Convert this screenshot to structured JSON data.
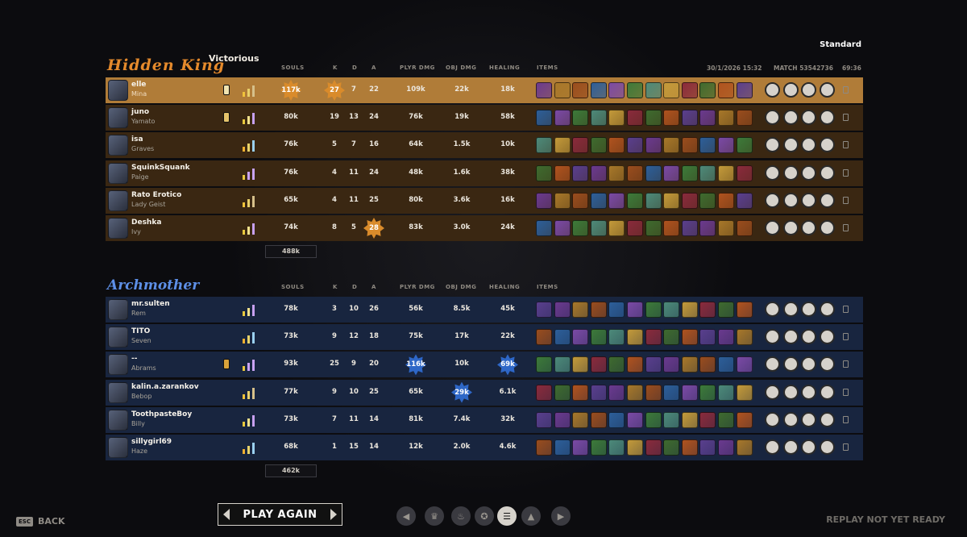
{
  "match": {
    "mode": "Standard",
    "date": "30/1/2026 15:32",
    "match_label": "MATCH 53542736",
    "duration": "69:36"
  },
  "columns": {
    "souls": "SOULS",
    "k": "K",
    "d": "D",
    "a": "A",
    "plyr_dmg": "PLYR DMG",
    "obj_dmg": "OBJ DMG",
    "healing": "HEALING",
    "items": "ITEMS"
  },
  "teams": [
    {
      "name": "Hidden King",
      "result": "Victorious",
      "total_souls": "488k",
      "players": [
        {
          "name": "elle",
          "hero": "Mina",
          "souls": "117k",
          "k": "27",
          "d": "7",
          "a": "22",
          "plyr_dmg": "109k",
          "obj_dmg": "22k",
          "healing": "18k",
          "highlight": true
        },
        {
          "name": "juno",
          "hero": "Yamato",
          "souls": "80k",
          "k": "19",
          "d": "13",
          "a": "24",
          "plyr_dmg": "76k",
          "obj_dmg": "19k",
          "healing": "58k"
        },
        {
          "name": "isa",
          "hero": "Graves",
          "souls": "76k",
          "k": "5",
          "d": "7",
          "a": "16",
          "plyr_dmg": "64k",
          "obj_dmg": "1.5k",
          "healing": "10k"
        },
        {
          "name": "SquinkSquank",
          "hero": "Paige",
          "souls": "76k",
          "k": "4",
          "d": "11",
          "a": "24",
          "plyr_dmg": "48k",
          "obj_dmg": "1.6k",
          "healing": "38k"
        },
        {
          "name": "Rato Erotico",
          "hero": "Lady Geist",
          "souls": "65k",
          "k": "4",
          "d": "11",
          "a": "25",
          "plyr_dmg": "80k",
          "obj_dmg": "3.6k",
          "healing": "16k"
        },
        {
          "name": "Deshka",
          "hero": "Ivy",
          "souls": "74k",
          "k": "8",
          "d": "5",
          "a": "28",
          "plyr_dmg": "83k",
          "obj_dmg": "3.0k",
          "healing": "24k"
        }
      ]
    },
    {
      "name": "Archmother",
      "result": "",
      "total_souls": "462k",
      "players": [
        {
          "name": "mr.sulten",
          "hero": "Rem",
          "souls": "78k",
          "k": "3",
          "d": "10",
          "a": "26",
          "plyr_dmg": "56k",
          "obj_dmg": "8.5k",
          "healing": "45k"
        },
        {
          "name": "TITO",
          "hero": "Seven",
          "souls": "73k",
          "k": "9",
          "d": "12",
          "a": "18",
          "plyr_dmg": "75k",
          "obj_dmg": "17k",
          "healing": "22k"
        },
        {
          "name": "--",
          "hero": "Abrams",
          "souls": "93k",
          "k": "25",
          "d": "9",
          "a": "20",
          "plyr_dmg": "116k",
          "obj_dmg": "10k",
          "healing": "69k"
        },
        {
          "name": "kalin.a.zarankov",
          "hero": "Bebop",
          "souls": "77k",
          "k": "9",
          "d": "10",
          "a": "25",
          "plyr_dmg": "65k",
          "obj_dmg": "29k",
          "healing": "6.1k"
        },
        {
          "name": "ToothpasteBoy",
          "hero": "Billy",
          "souls": "73k",
          "k": "7",
          "d": "11",
          "a": "14",
          "plyr_dmg": "81k",
          "obj_dmg": "7.4k",
          "healing": "32k"
        },
        {
          "name": "sillygirl69",
          "hero": "Haze",
          "souls": "68k",
          "k": "1",
          "d": "15",
          "a": "14",
          "plyr_dmg": "12k",
          "obj_dmg": "2.0k",
          "healing": "4.6k"
        }
      ]
    }
  ],
  "footer": {
    "esc_key": "ESC",
    "back_label": "BACK",
    "play_again": "PLAY AGAIN",
    "replay_status": "REPLAY NOT YET READY"
  },
  "colors": {
    "amber_accent": "#e58a2c",
    "sapphire_accent": "#5d8fe6",
    "highlight_row": "#b07c38"
  },
  "icons": [
    "arrow-left-icon",
    "trophy-icon",
    "flame-icon",
    "medal-icon",
    "list-icon",
    "chart-icon",
    "arrow-right-icon"
  ]
}
